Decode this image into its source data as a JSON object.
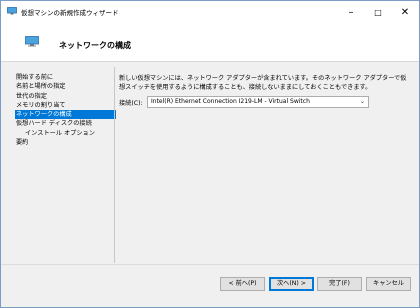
{
  "window": {
    "title": "仮想マシンの新規作成ウィザード",
    "icon": "vm-monitor-icon"
  },
  "header": {
    "title": "ネットワークの構成",
    "icon": "vm-monitor-icon"
  },
  "nav": {
    "items": [
      {
        "label": "開始する前に"
      },
      {
        "label": "名前と場所の指定"
      },
      {
        "label": "世代の指定"
      },
      {
        "label": "メモリの割り当て"
      },
      {
        "label": "ネットワークの構成"
      },
      {
        "label": "仮想ハード ディスクの接続"
      },
      {
        "label": "インストール オプション"
      },
      {
        "label": "要約"
      }
    ],
    "active_index": 4
  },
  "main": {
    "description": "新しい仮想マシンには、ネットワーク アダプターが含まれています。そのネットワーク アダプターで仮想スイッチを使用するように構成することも、接続しないままにしておくこともできます。",
    "connection_label": "接続(C):",
    "connection_value": "Intel(R) Ethernet Connection I219-LM - Virtual Switch"
  },
  "buttons": {
    "back": "< 前へ(P)",
    "next": "次へ(N) >",
    "finish": "完了(F)",
    "cancel": "キャンセル"
  },
  "colors": {
    "accent": "#0078d7",
    "window_border": "#7a9cc6"
  }
}
